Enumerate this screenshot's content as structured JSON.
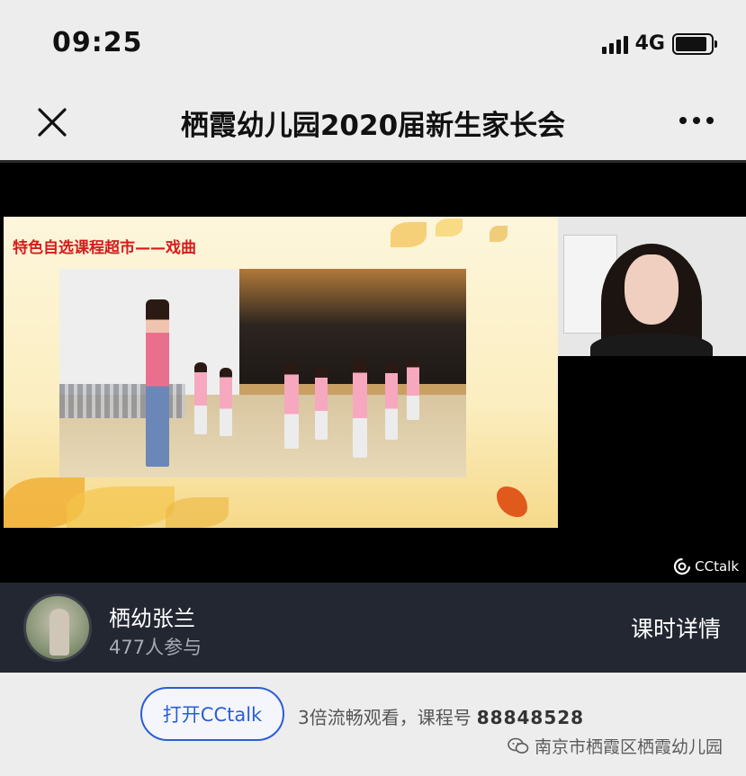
{
  "status_bar": {
    "time": "09:25",
    "network": "4G",
    "signal_bars": 4,
    "battery_level": 0.9
  },
  "nav": {
    "title": "栖霞幼儿园2020届新生家长会",
    "close_icon": "close-icon",
    "more_icon": "more-icon"
  },
  "slide": {
    "title": "特色自选课程超市——戏曲"
  },
  "player": {
    "brand": "CCtalk"
  },
  "host": {
    "name": "栖幼张兰",
    "participants": "477人参与",
    "details_label": "课时详情"
  },
  "footer": {
    "open_button": "打开CCtalk",
    "promo_text": "3倍流畅观看，课程号",
    "course_number": "88848528",
    "watermark": "南京市栖霞区栖霞幼儿园"
  },
  "colors": {
    "accent_blue": "#2a5ed6",
    "slide_title_red": "#d51b1b",
    "host_bar_bg": "#232731",
    "app_bg": "#ededed"
  }
}
